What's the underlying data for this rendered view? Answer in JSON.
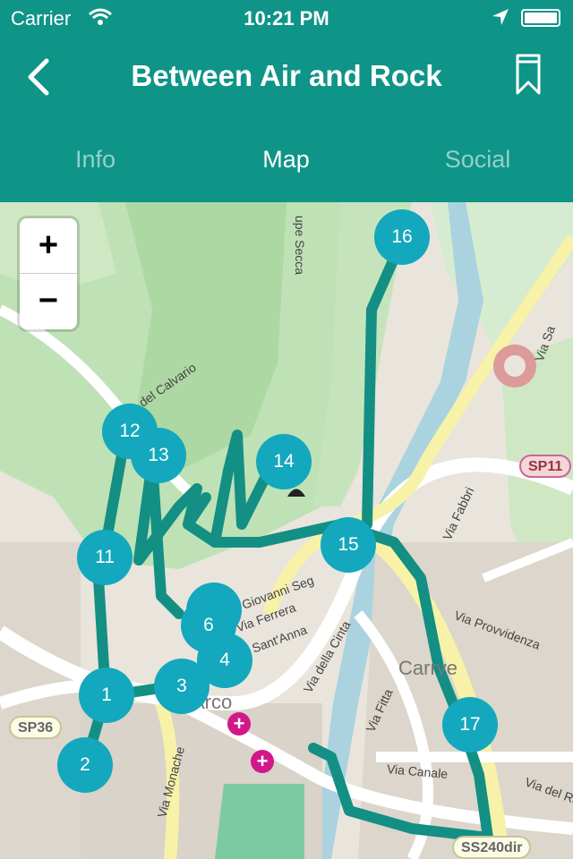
{
  "status_bar": {
    "carrier": "Carrier",
    "time": "10:21 PM"
  },
  "header": {
    "title": "Between Air and Rock",
    "back_icon": "chevron-left-icon",
    "bookmark_icon": "bookmark-icon"
  },
  "tabs": [
    {
      "label": "Info",
      "active": false
    },
    {
      "label": "Map",
      "active": true
    },
    {
      "label": "Social",
      "active": false
    }
  ],
  "map": {
    "zoom_in": "+",
    "zoom_out": "−",
    "markers": [
      "1",
      "2",
      "3",
      "4",
      "11",
      "12",
      "13",
      "14",
      "15",
      "16",
      "17"
    ],
    "stacked_markers": [
      "5",
      "6"
    ],
    "streets": {
      "calvario": "del Calvario",
      "secca": "upe Secca",
      "giovanni": "Via Giovanni Seg",
      "ferrera": "Via Ferrera",
      "anna": "Sant'Anna",
      "cinta": "Via della Cinta",
      "monache": "Via Monache",
      "fitta": "Via Fitta",
      "canale": "Via Canale",
      "provvidenza": "Via Provvidenza",
      "fabbri": "Via Fabbri",
      "del_ra": "Via del Ra",
      "sa": "Via Sa",
      "carrve": "Carrve",
      "arco": "Arco"
    },
    "road_shields": [
      "SP36",
      "SP11",
      "SS240dir"
    ],
    "colors": {
      "route": "#138f84",
      "marker": "#13a8bd",
      "header": "#0f9488"
    }
  }
}
